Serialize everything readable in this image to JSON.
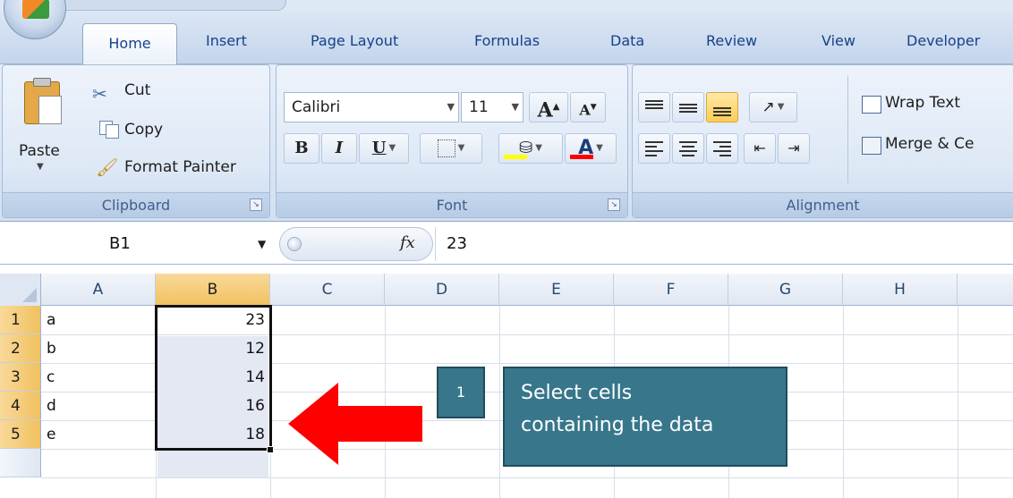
{
  "ribbon": {
    "tabs": [
      "Home",
      "Insert",
      "Page Layout",
      "Formulas",
      "Data",
      "Review",
      "View",
      "Developer"
    ],
    "active_tab": "Home",
    "clipboard": {
      "group_label": "Clipboard",
      "paste": "Paste",
      "cut": "Cut",
      "copy": "Copy",
      "format_painter": "Format Painter"
    },
    "font": {
      "group_label": "Font",
      "font_name": "Calibri",
      "font_size": "11",
      "grow": "A",
      "shrink": "A",
      "bold": "B",
      "italic": "I",
      "underline": "U",
      "font_color_glyph": "A",
      "fill_color": "#ffff00",
      "font_color": "#ff0000"
    },
    "alignment": {
      "group_label": "Alignment",
      "wrap_text": "Wrap Text",
      "merge": "Merge & Ce"
    }
  },
  "formula_bar": {
    "name_box": "B1",
    "fx": "fx",
    "value": "23"
  },
  "sheet": {
    "columns": [
      "A",
      "B",
      "C",
      "D",
      "E",
      "F",
      "G",
      "H"
    ],
    "selected_column": "B",
    "rows": [
      {
        "num": "1",
        "a": "a",
        "b": "23"
      },
      {
        "num": "2",
        "a": "b",
        "b": "12"
      },
      {
        "num": "3",
        "a": "c",
        "b": "14"
      },
      {
        "num": "4",
        "a": "d",
        "b": "16"
      },
      {
        "num": "5",
        "a": "e",
        "b": "18"
      }
    ]
  },
  "callout": {
    "step": "1",
    "line1": "Select cells",
    "line2": "containing the data",
    "arrow_color": "#ff0000",
    "box_color": "#37768b"
  }
}
